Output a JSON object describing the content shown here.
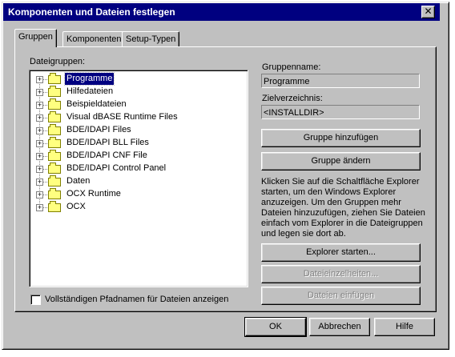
{
  "window": {
    "title": "Komponenten und Dateien festlegen",
    "close_glyph": "✕"
  },
  "tabs": [
    {
      "label": "Gruppen",
      "active": true
    },
    {
      "label": "Komponenten",
      "active": false
    },
    {
      "label": "Setup-Typen",
      "active": false
    }
  ],
  "groups": {
    "label": "Dateigruppen:",
    "items": [
      {
        "label": "Programme",
        "selected": true
      },
      {
        "label": "Hilfedateien"
      },
      {
        "label": "Beispieldateien"
      },
      {
        "label": "Visual dBASE Runtime Files"
      },
      {
        "label": "BDE/IDAPI Files"
      },
      {
        "label": "BDE/IDAPI BLL Files"
      },
      {
        "label": "BDE/IDAPI CNF File"
      },
      {
        "label": "BDE/IDAPI Control Panel"
      },
      {
        "label": "Daten"
      },
      {
        "label": "OCX Runtime"
      },
      {
        "label": "OCX"
      }
    ],
    "expander_glyph": "+",
    "icon": "folder-icon"
  },
  "details": {
    "group_name_label": "Gruppenname:",
    "group_name_value": "Programme",
    "target_dir_label": "Zielverzeichnis:",
    "target_dir_value": "<INSTALLDIR>",
    "add_group_button": "Gruppe hinzufügen",
    "change_group_button": "Gruppe ändern",
    "description": "Klicken Sie auf die Schaltfläche Explorer starten, um den Windows Explorer anzuzeigen. Um den Gruppen mehr Dateien hinzuzufügen, ziehen Sie Dateien einfach vom Explorer in die Dateigruppen und legen sie dort ab.",
    "explorer_button": "Explorer starten...",
    "file_details_button": "Dateieinzelheiten...",
    "insert_files_button": "Dateien einfügen"
  },
  "options": {
    "full_path_checkbox_label": "Vollständigen Pfadnamen für Dateien anzeigen",
    "full_path_checked": false
  },
  "footer": {
    "ok": "OK",
    "cancel": "Abbrechen",
    "help": "Hilfe"
  },
  "colors": {
    "face": "#c0c0c0",
    "titlebar": "#000080",
    "selection": "#000080",
    "folder": "#ffff80"
  }
}
